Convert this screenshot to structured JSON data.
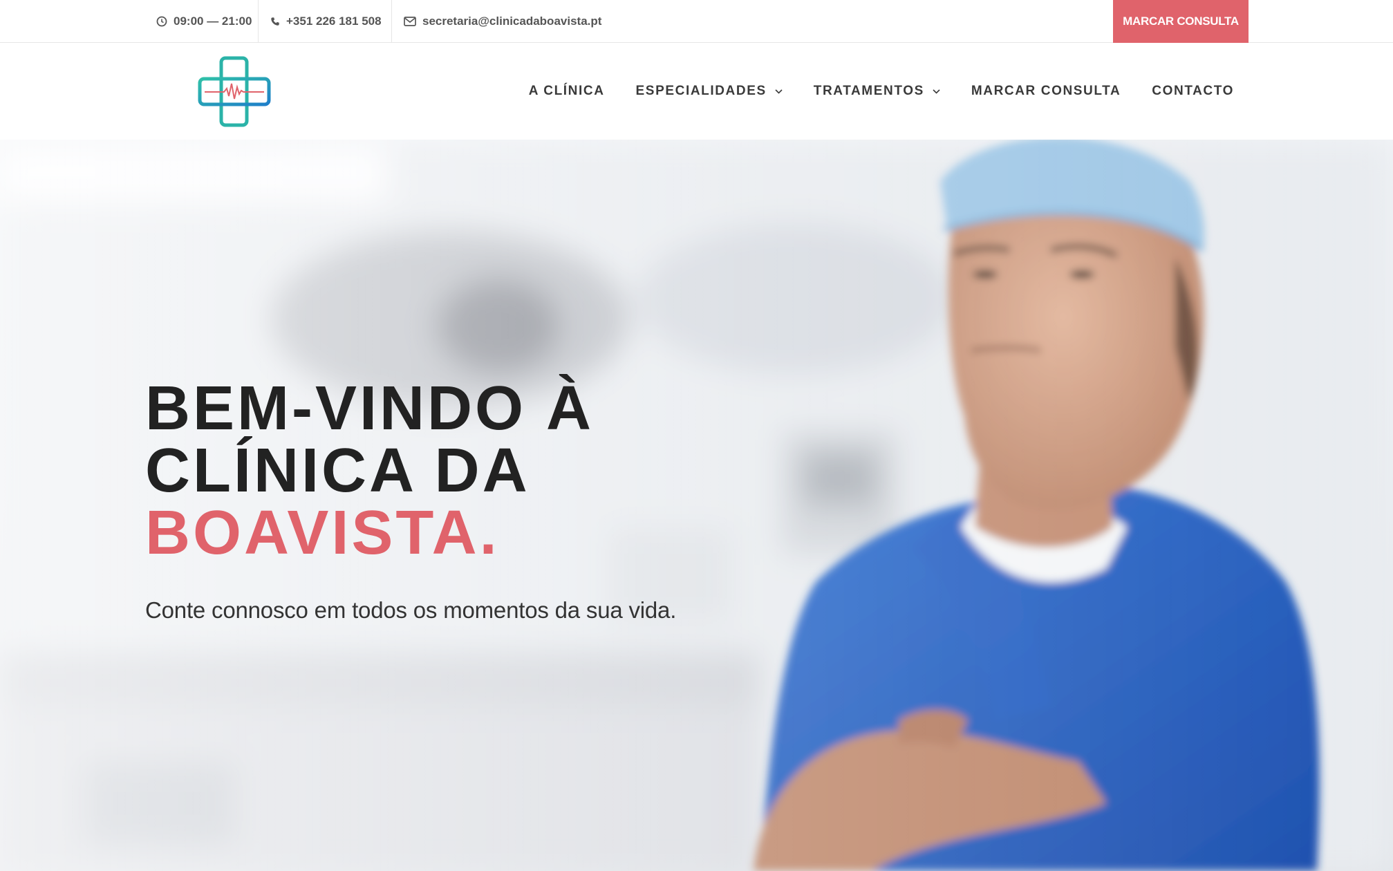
{
  "topbar": {
    "hours": "09:00 — 21:00",
    "phone": "+351 226 181 508",
    "email": "secretaria@clinicadaboavista.pt",
    "cta_label": "MARCAR CONSULTA",
    "icons": {
      "hours": "clock-icon",
      "phone": "phone-icon",
      "email": "mail-icon"
    }
  },
  "header": {
    "logo": "medical-cross-logo",
    "nav": [
      {
        "label": "A CLÍNICA",
        "dropdown": false
      },
      {
        "label": "ESPECIALIDADES",
        "dropdown": true
      },
      {
        "label": "TRATAMENTOS",
        "dropdown": true
      },
      {
        "label": "MARCAR CONSULTA",
        "dropdown": false
      },
      {
        "label": "CONTACTO",
        "dropdown": false
      }
    ]
  },
  "hero": {
    "title_line1": "BEM-VINDO À",
    "title_line2": "CLÍNICA DA",
    "title_accent": "BOAVISTA.",
    "subtitle": "Conte connosco em todos os momentos da sua vida.",
    "image": "doctor-in-blue-scrubs-photo"
  },
  "colors": {
    "accent": "#e0636b",
    "text_dark": "#222222",
    "logo_teal": "#2bb3a8",
    "logo_blue": "#1e88c9"
  }
}
